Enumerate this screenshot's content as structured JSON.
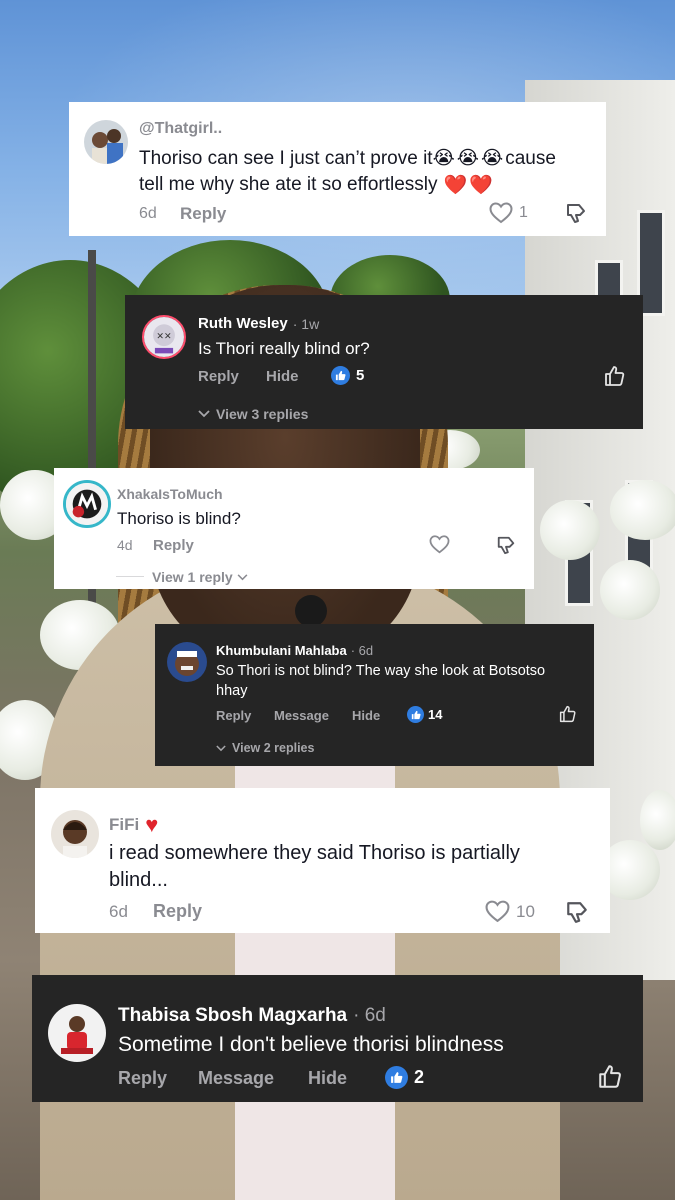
{
  "comments": [
    {
      "username": "@Thatgirl..",
      "text_line1": "Thoriso can see I just can’t prove it",
      "emojis": "😭😭😭",
      "text_line1_end": " cause",
      "text_line2": "tell me why she ate it so effortlessly",
      "hearts": "❤️❤️",
      "time": "6d",
      "reply": "Reply",
      "likes": "1"
    },
    {
      "username": "Ruth Wesley",
      "time": "· 1w",
      "text": "Is Thori really blind or?",
      "reply": "Reply",
      "hide": "Hide",
      "likes": "5",
      "replies": "View 3 replies"
    },
    {
      "username": "XhakaIsToMuch",
      "text": "Thoriso is blind?",
      "time": "4d",
      "reply": "Reply",
      "replies": "View 1 reply"
    },
    {
      "username": "Khumbulani Mahlaba",
      "time": "· 6d",
      "text_line1": "So Thori is not blind? The way she look at Botsotso",
      "text_line2": "hhay",
      "reply": "Reply",
      "message": "Message",
      "hide": "Hide",
      "likes": "14",
      "replies": "View 2 replies"
    },
    {
      "username": "FiFi",
      "username_heart": "♥",
      "text_line1": "i read somewhere they said Thoriso is partially",
      "text_line2": "blind...",
      "time": "6d",
      "reply": "Reply",
      "likes": "10"
    },
    {
      "username": "Thabisa Sbosh Magxarha",
      "time": "· 6d",
      "text": "Sometime I don't believe thorisi blindness",
      "reply": "Reply",
      "message": "Message",
      "hide": "Hide",
      "likes": "2"
    }
  ],
  "colors": {
    "like_blue": "#2f7de1",
    "dark_card": "#252525",
    "light_card": "#ffffff",
    "heart_red": "#e0242c"
  },
  "icons": {
    "like": "heart-outline-icon",
    "dislike": "thumbs-down-icon",
    "thumbs_up": "thumbs-up-icon",
    "liked": "thumbs-up-filled-icon",
    "expand": "chevron-down-icon"
  }
}
